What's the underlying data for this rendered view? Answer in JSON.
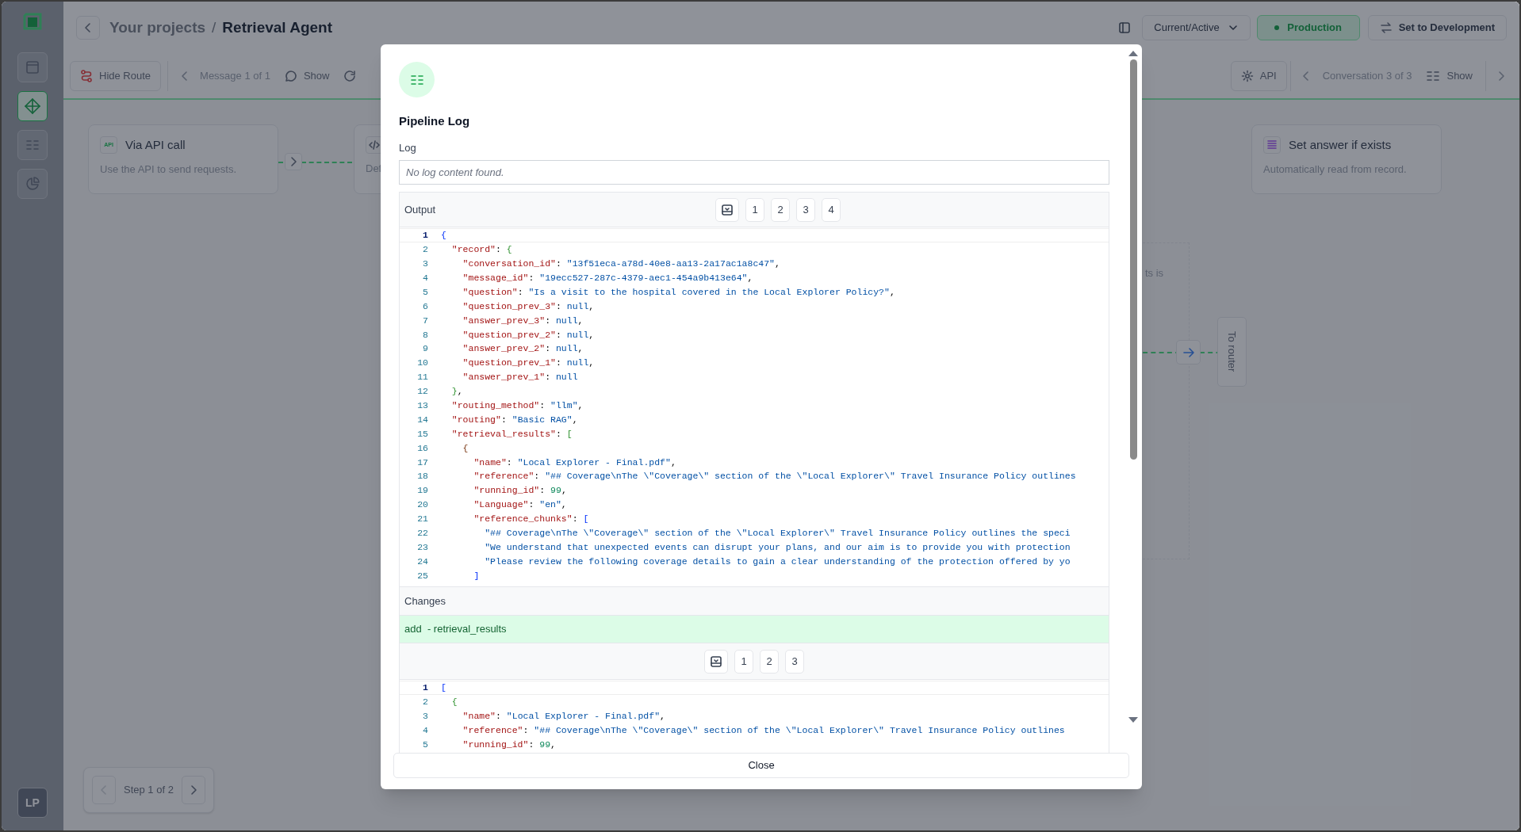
{
  "sidebar": {
    "items": [
      {
        "selected": false
      },
      {
        "selected": true
      },
      {
        "selected": false
      },
      {
        "selected": false
      }
    ],
    "avatar": "LP"
  },
  "header": {
    "breadcrumb_parent": "Your projects",
    "separator": "/",
    "title": "Retrieval Agent",
    "version_select": "Current/Active",
    "environment": "Production",
    "switch_button": "Set to Development"
  },
  "toolbar": {
    "hide_route": "Hide Route",
    "message_pager": "Message 1 of 1",
    "show_message": "Show",
    "api": "API",
    "conversation_pager": "Conversation 3 of 3",
    "show_conversation": "Show"
  },
  "canvas": {
    "nodes": [
      {
        "badge": "API",
        "title": "Via API call",
        "description": "Use the API to send requests."
      },
      {
        "description": "Def"
      },
      {
        "title": "Set answer if exists",
        "description": "Automatically read from record."
      }
    ],
    "partial_text": "ts is",
    "router": "To router",
    "step_pager": "Step 1 of 2"
  },
  "modal": {
    "title": "Pipeline Log",
    "log_label": "Log",
    "log_placeholder": "No log content found.",
    "output": {
      "label": "Output",
      "pages": [
        "1",
        "2",
        "3",
        "4"
      ],
      "lines": [
        {
          "n": "1",
          "text": "{"
        },
        {
          "n": "2",
          "text": "  \"record\": {"
        },
        {
          "n": "3",
          "text": "    \"conversation_id\": \"13f51eca-a78d-40e8-aa13-2a17ac1a8c47\","
        },
        {
          "n": "4",
          "text": "    \"message_id\": \"19ecc527-287c-4379-aec1-454a9b413e64\","
        },
        {
          "n": "5",
          "text": "    \"question\": \"Is a visit to the hospital covered in the Local Explorer Policy?\","
        },
        {
          "n": "6",
          "text": "    \"question_prev_3\": null,"
        },
        {
          "n": "7",
          "text": "    \"answer_prev_3\": null,"
        },
        {
          "n": "8",
          "text": "    \"question_prev_2\": null,"
        },
        {
          "n": "9",
          "text": "    \"answer_prev_2\": null,"
        },
        {
          "n": "10",
          "text": "    \"question_prev_1\": null,"
        },
        {
          "n": "11",
          "text": "    \"answer_prev_1\": null"
        },
        {
          "n": "12",
          "text": "  },"
        },
        {
          "n": "13",
          "text": "  \"routing_method\": \"llm\","
        },
        {
          "n": "14",
          "text": "  \"routing\": \"Basic RAG\","
        },
        {
          "n": "15",
          "text": "  \"retrieval_results\": ["
        },
        {
          "n": "16",
          "text": "    {"
        },
        {
          "n": "17",
          "text": "      \"name\": \"Local Explorer - Final.pdf\","
        },
        {
          "n": "18",
          "text": "      \"reference\": \"## Coverage\\nThe \\\"Coverage\\\" section of the \\\"Local Explorer\\\" Travel Insurance Policy outlines"
        },
        {
          "n": "19",
          "text": "      \"running_id\": 99,"
        },
        {
          "n": "20",
          "text": "      \"Language\": \"en\","
        },
        {
          "n": "21",
          "text": "      \"reference_chunks\": ["
        },
        {
          "n": "22",
          "text": "        \"## Coverage\\nThe \\\"Coverage\\\" section of the \\\"Local Explorer\\\" Travel Insurance Policy outlines the speci"
        },
        {
          "n": "23",
          "text": "        \"We understand that unexpected events can disrupt your plans, and our aim is to provide you with protection"
        },
        {
          "n": "24",
          "text": "        \"Please review the following coverage details to gain a clear understanding of the protection offered by yo"
        },
        {
          "n": "25",
          "text": "      ]"
        }
      ]
    },
    "changes": {
      "label": "Changes",
      "items": [
        {
          "kind": "add",
          "text": "add  - retrieval_results"
        }
      ],
      "pages": [
        "1",
        "2",
        "3"
      ],
      "lines": [
        {
          "n": "1",
          "text": "["
        },
        {
          "n": "2",
          "text": "  {"
        },
        {
          "n": "3",
          "text": "    \"name\": \"Local Explorer - Final.pdf\","
        },
        {
          "n": "4",
          "text": "    \"reference\": \"## Coverage\\nThe \\\"Coverage\\\" section of the \\\"Local Explorer\\\" Travel Insurance Policy outlines"
        },
        {
          "n": "5",
          "text": "    \"running_id\": 99,"
        }
      ]
    },
    "close": "Close"
  }
}
